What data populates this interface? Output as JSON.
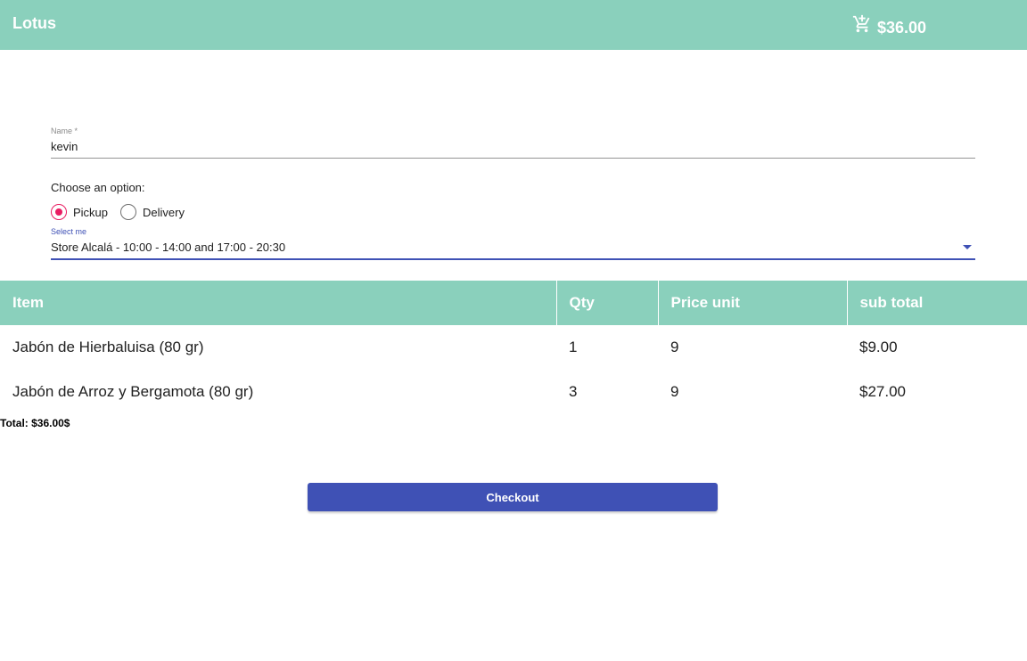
{
  "header": {
    "brand": "Lotus",
    "cart_icon": "add-shopping-cart-icon",
    "cart_total": "$36.00"
  },
  "form": {
    "name_label": "Name *",
    "name_value": "kevin",
    "option_prompt": "Choose an option:",
    "options": [
      {
        "label": "Pickup",
        "checked": true
      },
      {
        "label": "Delivery",
        "checked": false
      }
    ],
    "select_label": "Select me",
    "select_value": "Store Alcalá - 10:00 - 14:00 and 17:00 - 20:30"
  },
  "table": {
    "headers": [
      "Item",
      "Qty",
      "Price unit",
      "sub total"
    ],
    "rows": [
      [
        "Jabón de Hierbaluisa (80 gr)",
        "1",
        "9",
        "$9.00"
      ],
      [
        "Jabón de Arroz y Bergamota (80 gr)",
        "3",
        "9",
        "$27.00"
      ]
    ]
  },
  "total": "Total: $36.00$",
  "checkout_label": "Checkout",
  "colors": {
    "toolbar": "#8ad0bc",
    "primary": "#3f51b5",
    "radio_accent": "#e91e63"
  }
}
